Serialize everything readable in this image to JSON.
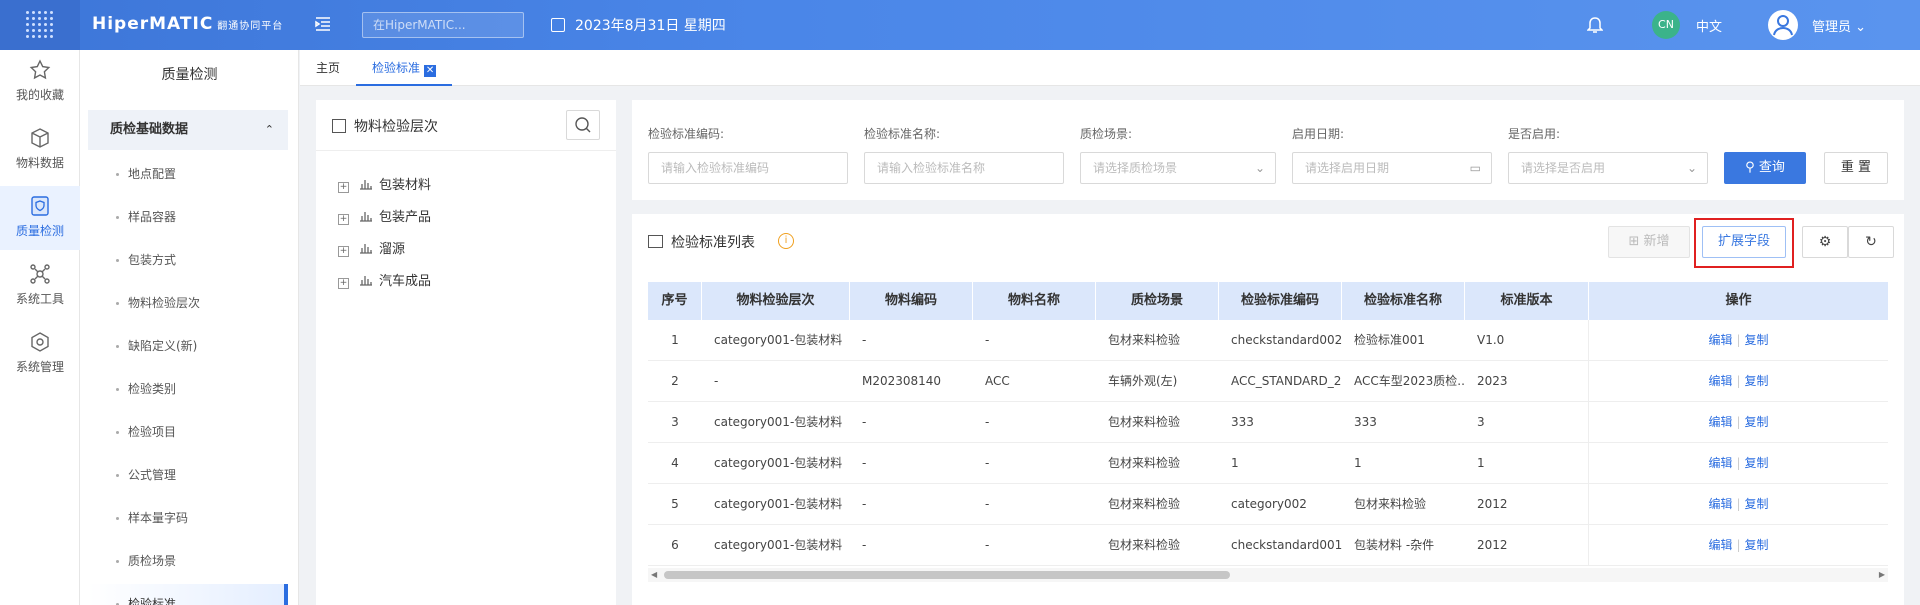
{
  "header": {
    "brand": "HiperMATIC",
    "brand_sub": "翻通协同平台",
    "search_placeholder": "在HiperMATIC...",
    "date": "2023年8月31日 星期四",
    "lang_badge": "CN",
    "lang": "中文",
    "user": "管理员",
    "accent": "#4a86e8"
  },
  "leftbar": [
    {
      "label": "我的收藏",
      "icon": "star-icon"
    },
    {
      "label": "物料数据",
      "icon": "cube-icon"
    },
    {
      "label": "质量检测",
      "icon": "shield-icon",
      "active": true
    },
    {
      "label": "系统工具",
      "icon": "network-icon"
    },
    {
      "label": "系统管理",
      "icon": "box-icon"
    }
  ],
  "submenu": {
    "title": "质量检测",
    "group": "质检基础数据",
    "items": [
      "地点配置",
      "样品容器",
      "包装方式",
      "物料检验层次",
      "缺陷定义(新)",
      "检验类别",
      "检验项目",
      "公式管理",
      "样本量字码",
      "质检场景",
      "检验标准"
    ]
  },
  "tabs": {
    "home": "主页",
    "current": "检验标准"
  },
  "tree": {
    "title": "物料检验层次",
    "nodes": [
      "包装材料",
      "包装产品",
      "溜源",
      "汽车成品"
    ]
  },
  "filters": {
    "code_label": "检验标准编码:",
    "code_placeholder": "请输入检验标准编码",
    "name_label": "检验标准名称:",
    "name_placeholder": "请输入检验标准名称",
    "scene_label": "质检场景:",
    "scene_placeholder": "请选择质检场景",
    "date_label": "启用日期:",
    "date_placeholder": "请选择启用日期",
    "enabled_label": "是否启用:",
    "enabled_placeholder": "请选择是否启用",
    "query": "查询",
    "reset": "重 置"
  },
  "list": {
    "title": "检验标准列表",
    "add": "新增",
    "ext": "扩展字段",
    "columns": [
      "序号",
      "物料检验层次",
      "物料编码",
      "物料名称",
      "质检场景",
      "检验标准编码",
      "检验标准名称",
      "标准版本",
      "操作"
    ],
    "rows": [
      [
        "1",
        "category001-包装材料",
        "-",
        "-",
        "包材来料检验",
        "checkstandard002",
        "检验标准001",
        "V1.0"
      ],
      [
        "2",
        "-",
        "M202308140",
        "ACC",
        "车辆外观(左)",
        "ACC_STANDARD_2...",
        "ACC车型2023质检...",
        "2023"
      ],
      [
        "3",
        "category001-包装材料",
        "-",
        "-",
        "包材来料检验",
        "333",
        "333",
        "3"
      ],
      [
        "4",
        "category001-包装材料",
        "-",
        "-",
        "包材来料检验",
        "1",
        "1",
        "1"
      ],
      [
        "5",
        "category001-包装材料",
        "-",
        "-",
        "包材来料检验",
        "category002",
        "包材来料检验",
        "2012"
      ],
      [
        "6",
        "category001-包装材料",
        "-",
        "-",
        "包材来料检验",
        "checkstandard001",
        "包装材料 -杂件",
        "2012"
      ]
    ],
    "edit": "编辑",
    "copy": "复制"
  }
}
